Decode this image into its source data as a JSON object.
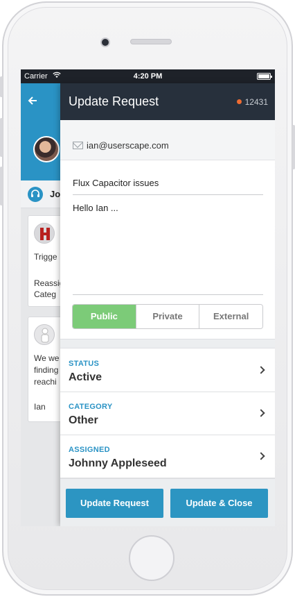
{
  "status_bar": {
    "carrier": "Carrier",
    "time": "4:20 PM"
  },
  "background": {
    "back_icon": "back-arrow-icon",
    "user_name": "Jo",
    "card1": {
      "line1": "Trigge",
      "line2": "Reassig",
      "line3": "Categ"
    },
    "card2": {
      "line1": "We we",
      "line2": "finding",
      "line3": "reachi",
      "line4": "Ian"
    }
  },
  "modal": {
    "title": "Update Request",
    "request_id": "12431",
    "status_dot_color": "#ef6c32",
    "email": "ian@userscape.com",
    "subject": "Flux Capacitor issues",
    "body": "Hello Ian ...",
    "visibility": {
      "options": [
        "Public",
        "Private",
        "External"
      ],
      "selected": "Public"
    },
    "fields": [
      {
        "label": "STATUS",
        "value": "Active"
      },
      {
        "label": "CATEGORY",
        "value": "Other"
      },
      {
        "label": "ASSIGNED",
        "value": "Johnny Appleseed"
      }
    ],
    "buttons": {
      "update": "Update Request",
      "update_close": "Update & Close"
    }
  },
  "colors": {
    "accent": "#2a93c5",
    "header": "#27303c",
    "public_selected": "#7ccb78"
  }
}
